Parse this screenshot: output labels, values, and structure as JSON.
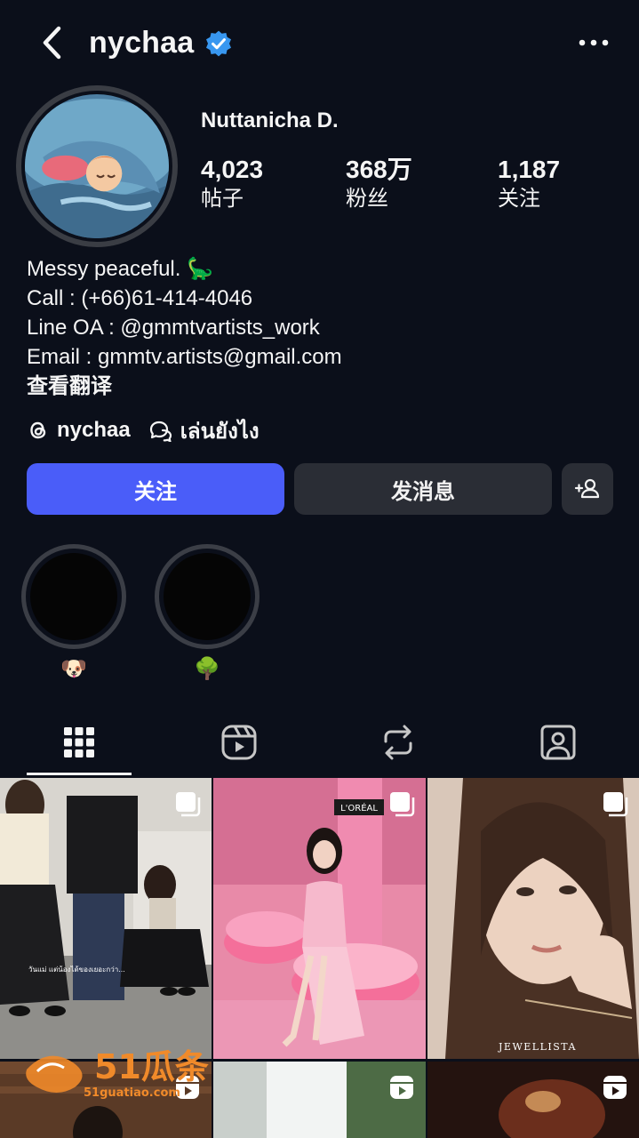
{
  "header": {
    "username": "nychaa",
    "verified_icon": "verified-badge-icon"
  },
  "profile": {
    "display_name": "Nuttanicha D.",
    "stats": [
      {
        "value": "4,023",
        "label": "帖子"
      },
      {
        "value": "368万",
        "label": "粉丝"
      },
      {
        "value": "1,187",
        "label": "关注"
      }
    ],
    "bio": [
      "Messy peaceful. 🦕",
      "Call : (+66)61-414-4046",
      "Line OA : @gmmtvartists_work",
      "Email : gmmtv.artists@gmail.com"
    ],
    "translate_label": "查看翻译",
    "links": [
      {
        "icon": "threads-icon",
        "label": "nychaa"
      },
      {
        "icon": "chat-bubble-icon",
        "label": "เล่นยังไง"
      }
    ]
  },
  "actions": {
    "follow_label": "关注",
    "message_label": "发消息"
  },
  "highlights": [
    {
      "emoji": "🐶"
    },
    {
      "emoji": "🌳"
    }
  ],
  "tabs": [
    {
      "icon": "grid-icon",
      "active": true
    },
    {
      "icon": "reels-icon",
      "active": false
    },
    {
      "icon": "repost-icon",
      "active": false
    },
    {
      "icon": "tagged-icon",
      "active": false
    }
  ],
  "grid": {
    "posts": [
      {
        "caption": "วันแม่ แต่น้องได้ของเยอะกว่า...",
        "badge": "multi-photo-icon"
      },
      {
        "caption": "L'ORÉAL",
        "badge": "multi-photo-icon"
      },
      {
        "caption": "JEWELLISTA",
        "badge": "multi-photo-icon"
      },
      {
        "caption": "",
        "badge": "reel-icon"
      },
      {
        "caption": "",
        "badge": "reel-icon"
      },
      {
        "caption": "",
        "badge": "reel-icon"
      }
    ]
  },
  "watermark": {
    "brand": "51瓜条",
    "domain": "51guatiao.com"
  },
  "colors": {
    "background": "#0b0f1a",
    "follow_button": "#4a5df9",
    "secondary_button": "#2a2d35",
    "verified": "#3897f0"
  }
}
